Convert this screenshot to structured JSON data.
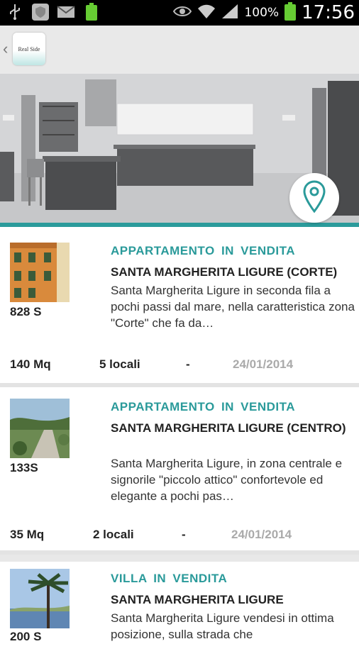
{
  "status_bar": {
    "battery_pct": "100%",
    "time": "17:56"
  },
  "app": {
    "logo_text": "Real Side"
  },
  "listings": [
    {
      "type": "APPARTAMENTO IN VENDITA",
      "place": "SANTA MARGHERITA LIGURE (CORTE)",
      "price": "828 S",
      "description": "Santa Margherita Ligure in seconda fila a pochi passi dal mare, nella caratteristica zona \"Corte\" che fa da…",
      "area": "140 Mq",
      "rooms": "5 locali",
      "sep": "-",
      "date": "24/01/2014"
    },
    {
      "type": "APPARTAMENTO IN VENDITA",
      "place": "SANTA MARGHERITA LIGURE (CENTRO)",
      "price": "133S",
      "description": "Santa Margherita Ligure, in zona centrale e signorile \"piccolo attico\" confortevole ed elegante a pochi pas…",
      "area": "35 Mq",
      "rooms": "2 locali",
      "sep": "-",
      "date": "24/01/2014"
    },
    {
      "type": "VILLA IN VENDITA",
      "place": "SANTA MARGHERITA LIGURE",
      "price": "200 S",
      "description": "Santa Margherita Ligure vendesi in ottima posizione, sulla strada che"
    }
  ],
  "colors": {
    "accent": "#2a9a9a",
    "date_gray": "#aaaaaa"
  },
  "icons": {
    "map_button": "map-pin-icon"
  }
}
